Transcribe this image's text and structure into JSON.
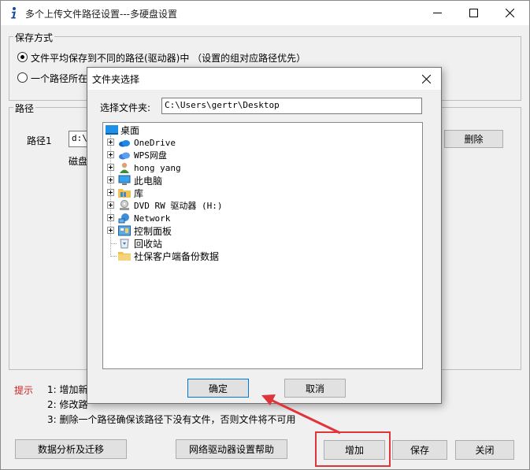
{
  "window": {
    "title": "多个上传文件路径设置---多硬盘设置",
    "icon": "info-i-icon",
    "controls": [
      "minimize-icon",
      "maximize-icon",
      "close-icon"
    ]
  },
  "save_mode": {
    "group_label": "保存方式",
    "option1": "文件平均保存到不同的路径(驱动器)中 （设置的组对应路径优先）",
    "option1_selected": true,
    "option2": "一个路径所在"
  },
  "paths": {
    "group_label": "路径",
    "path1_label": "路径1",
    "path1_value": "d:\\d",
    "disk_label": "磁盘",
    "delete_button": "删除"
  },
  "hints": {
    "label": "提示",
    "line1": "1: 增加新",
    "line2": "2: 修改路",
    "line3": "3: 删除一个路径确保该路径下没有文件，否则文件将不可用"
  },
  "buttons": {
    "data_analysis": "数据分析及迁移",
    "network_help": "网络驱动器设置帮助",
    "add": "增加",
    "save": "保存",
    "close": "关闭"
  },
  "dialog": {
    "title": "文件夹选择",
    "folder_label": "选择文件夹:",
    "folder_value": "C:\\Users\\gertr\\Desktop",
    "ok": "确定",
    "cancel": "取消",
    "tree": {
      "root": "桌面",
      "items": [
        {
          "label": "OneDrive",
          "icon": "cloud-icon",
          "expandable": true
        },
        {
          "label": "WPS网盘",
          "icon": "wps-cloud-icon",
          "expandable": true
        },
        {
          "label": "hong yang",
          "icon": "user-icon",
          "expandable": true
        },
        {
          "label": "此电脑",
          "icon": "computer-icon",
          "expandable": true
        },
        {
          "label": "库",
          "icon": "library-folder-icon",
          "expandable": true
        },
        {
          "label": "DVD RW 驱动器 (H:)",
          "icon": "dvd-drive-icon",
          "expandable": true
        },
        {
          "label": "Network",
          "icon": "network-icon",
          "expandable": true
        },
        {
          "label": "控制面板",
          "icon": "control-panel-icon",
          "expandable": true
        },
        {
          "label": "回收站",
          "icon": "recycle-bin-icon",
          "expandable": false
        },
        {
          "label": "社保客户端备份数据",
          "icon": "folder-icon",
          "expandable": false
        }
      ]
    }
  },
  "annotation": {
    "highlight_color": "#e0343b",
    "arrow_color": "#e0343b"
  }
}
